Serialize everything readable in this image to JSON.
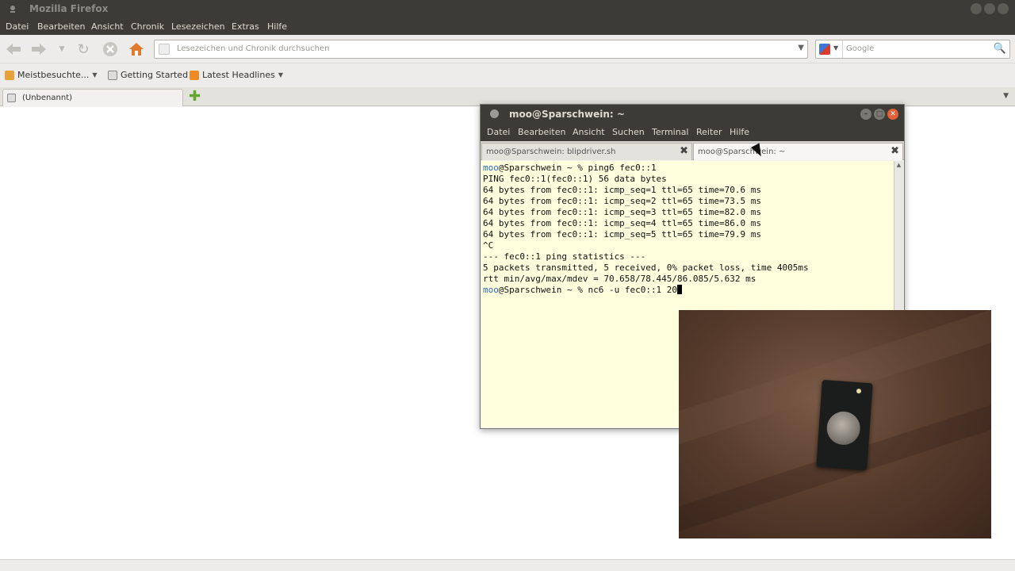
{
  "firefox": {
    "title": "Mozilla Firefox",
    "menu": [
      "Datei",
      "Bearbeiten",
      "Ansicht",
      "Chronik",
      "Lesezeichen",
      "Extras",
      "Hilfe"
    ],
    "urlbar_placeholder": "Lesezeichen und Chronik durchsuchen",
    "search_placeholder": "Google",
    "bookmarks": [
      "Meistbesuchte...",
      "Getting Started",
      "Latest Headlines"
    ],
    "tab_label": "(Unbenannt)"
  },
  "terminal": {
    "title": "moo@Sparschwein: ~",
    "menu": [
      "Datei",
      "Bearbeiten",
      "Ansicht",
      "Suchen",
      "Terminal",
      "Reiter",
      "Hilfe"
    ],
    "tabs": [
      "moo@Sparschwein: blipdriver.sh",
      "moo@Sparschwein: ~"
    ],
    "prompt_user": "moo",
    "prompt_rest": "@Sparschwein ~ % ",
    "command1": "ping6 fec0::1",
    "output": [
      "PING fec0::1(fec0::1) 56 data bytes",
      "64 bytes from fec0::1: icmp_seq=1 ttl=65 time=70.6 ms",
      "64 bytes from fec0::1: icmp_seq=2 ttl=65 time=73.5 ms",
      "64 bytes from fec0::1: icmp_seq=3 ttl=65 time=82.0 ms",
      "64 bytes from fec0::1: icmp_seq=4 ttl=65 time=86.0 ms",
      "64 bytes from fec0::1: icmp_seq=5 ttl=65 time=79.9 ms",
      "^C",
      "--- fec0::1 ping statistics ---",
      "5 packets transmitted, 5 received, 0% packet loss, time 4005ms",
      "rtt min/avg/max/mdev = 70.658/78.445/86.085/5.632 ms"
    ],
    "command2": "nc6 -u fec0::1 20"
  },
  "colors": {
    "chrome_dark": "#3c3b37",
    "terminal_bg": "#ffffde",
    "prompt_user": "#2f6bb5",
    "close_button": "#e35f35"
  },
  "icons": {
    "back": "arrow-left-icon",
    "forward": "arrow-right-icon",
    "reload": "reload-icon",
    "stop": "stop-icon",
    "home": "home-icon",
    "search": "magnifier-icon",
    "new_tab": "plus-icon",
    "close_tab": "close-icon"
  }
}
